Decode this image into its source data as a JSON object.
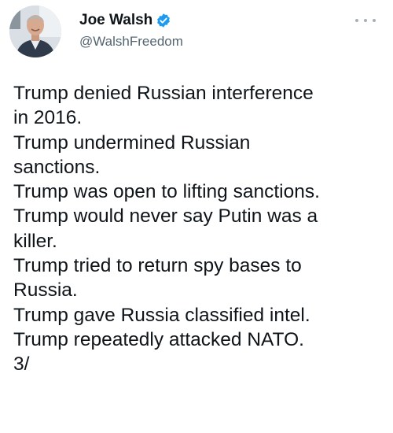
{
  "author": {
    "display_name": "Joe Walsh",
    "handle": "@WalshFreedom",
    "verified": true,
    "avatar_icon": "profile-photo",
    "verified_icon": "verified-badge-icon",
    "verified_color": "#1d9bf0"
  },
  "menu": {
    "icon": "more-options-icon"
  },
  "tweet": {
    "lines": [
      "Trump denied Russian interference",
      "in 2016.",
      "Trump undermined Russian",
      "sanctions.",
      "Trump was open to lifting sanctions.",
      "Trump would never say Putin was a",
      "killer.",
      "Trump tried to return spy bases to",
      "Russia.",
      "Trump gave Russia classified intel.",
      "Trump repeatedly attacked NATO.",
      "3/"
    ]
  }
}
